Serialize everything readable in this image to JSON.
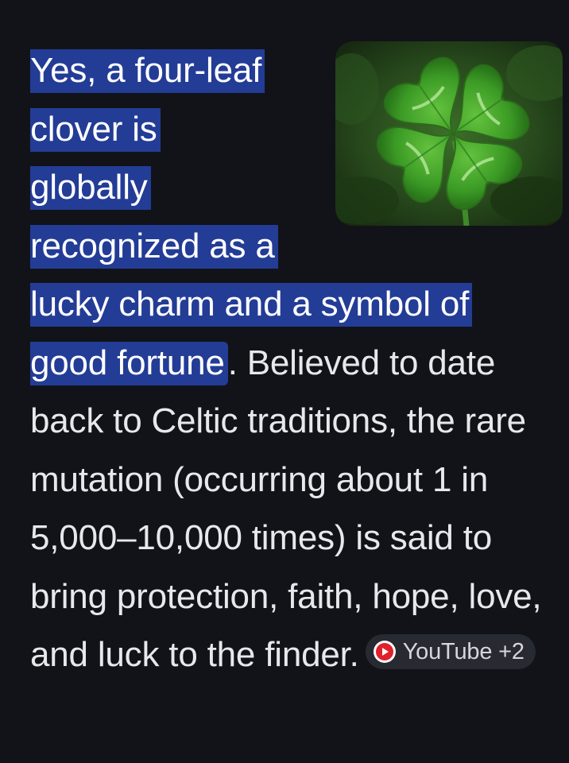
{
  "answer": {
    "highlighted_lines": [
      "Yes, a four-leaf",
      "clover is",
      "globally",
      "recognized as a",
      "lucky charm and a symbol of",
      "good fortune"
    ],
    "body_text": ". Believed to date back to Celtic traditions, the rare mutation (occurring about 1 in 5,000–10,000 times) is said to bring protection, faith, hope, love, and luck to the finder."
  },
  "source_chip": {
    "label": "YouTube +2",
    "icon": "youtube-icon"
  },
  "image": {
    "subject": "four-leaf-clover-icon"
  },
  "colors": {
    "background": "#121318",
    "highlight": "#233c96",
    "text": "#e8e8ec",
    "chip_background": "#272a31",
    "youtube_red": "#e0202a"
  }
}
